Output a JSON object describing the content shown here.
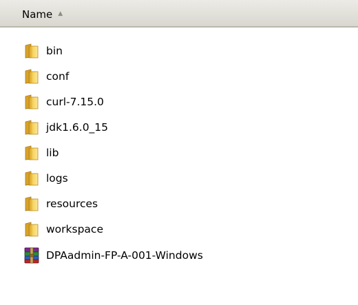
{
  "column_header": {
    "name_label": "Name",
    "sort_icon": "sort-ascending-icon"
  },
  "items": [
    {
      "name": "bin",
      "type": "folder",
      "icon": "folder-icon"
    },
    {
      "name": "conf",
      "type": "folder",
      "icon": "folder-icon"
    },
    {
      "name": "curl-7.15.0",
      "type": "folder",
      "icon": "folder-icon"
    },
    {
      "name": "jdk1.6.0_15",
      "type": "folder",
      "icon": "folder-icon"
    },
    {
      "name": "lib",
      "type": "folder",
      "icon": "folder-icon"
    },
    {
      "name": "logs",
      "type": "folder",
      "icon": "folder-icon"
    },
    {
      "name": "resources",
      "type": "folder",
      "icon": "folder-icon"
    },
    {
      "name": "workspace",
      "type": "folder",
      "icon": "folder-icon"
    },
    {
      "name": "DPAadmin-FP-A-001-Windows",
      "type": "archive",
      "icon": "winrar-archive-icon"
    }
  ],
  "colors": {
    "header_bg": "#dcdad2",
    "folder_yellow": "#f5c94a",
    "text": "#000000"
  }
}
